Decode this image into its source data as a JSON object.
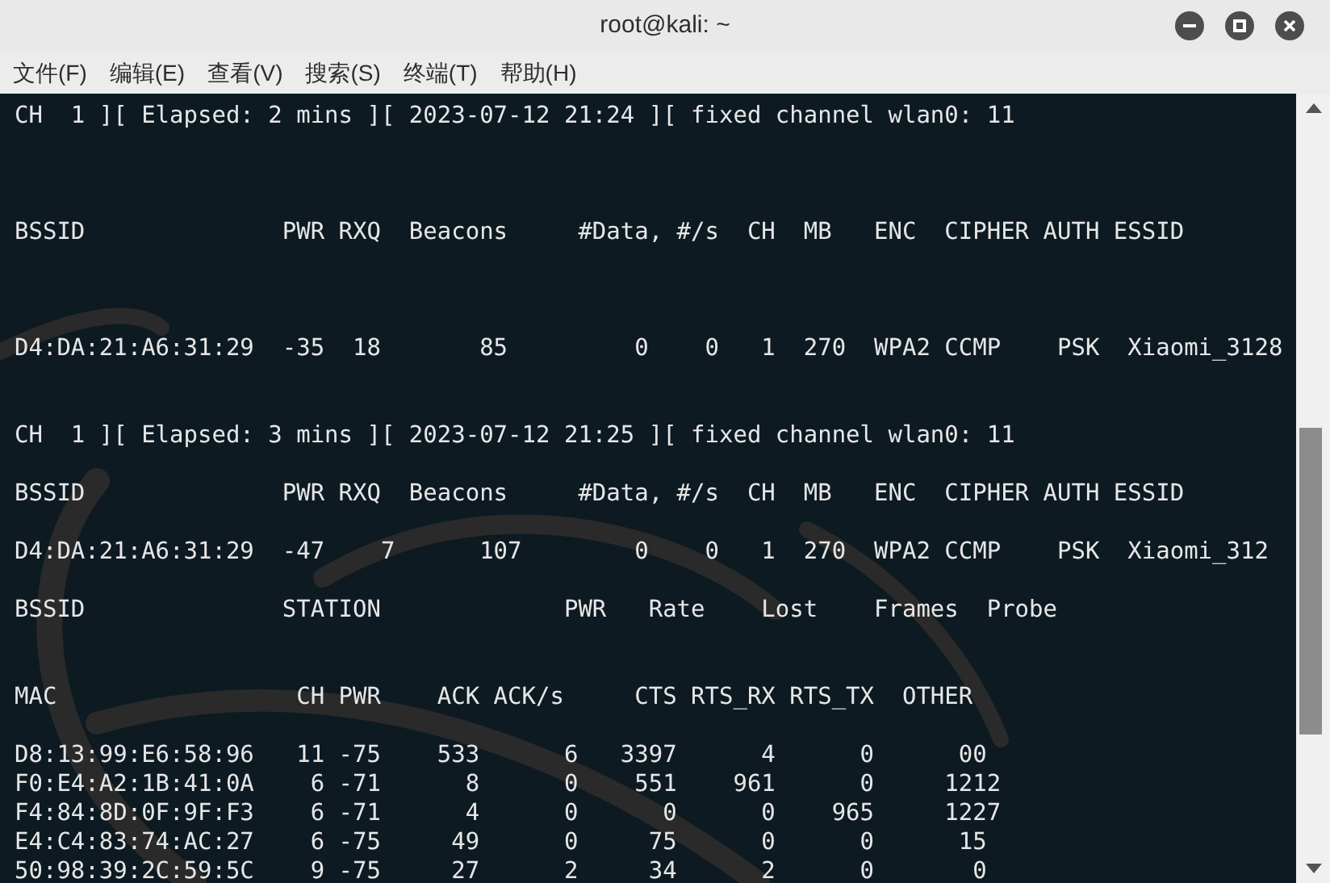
{
  "window": {
    "title": "root@kali: ~"
  },
  "menu": [
    "文件(F)",
    "编辑(E)",
    "查看(V)",
    "搜索(S)",
    "终端(T)",
    "帮助(H)"
  ],
  "terminal_lines": [
    "CH  1 ][ Elapsed: 2 mins ][ 2023-07-12 21:24 ][ fixed channel wlan0: 11",
    "BSSID              PWR RXQ  Beacons     #Data, #/s  CH  MB   ENC  CIPHER AUTH ESSID",
    "D4:DA:21:A6:31:29  -35  18       85         0    0   1  270  WPA2 CCMP    PSK  Xiaomi_3128",
    "CH  1 ][ Elapsed: 3 mins ][ 2023-07-12 21:25 ][ fixed channel wlan0: 11",
    "BSSID              PWR RXQ  Beacons     #Data, #/s  CH  MB   ENC  CIPHER AUTH ESSID",
    "D4:DA:21:A6:31:29  -47    7      107        0    0   1  270  WPA2 CCMP    PSK  Xiaomi_312",
    "BSSID              STATION             PWR   Rate    Lost    Frames  Probe",
    "MAC                 CH PWR    ACK ACK/s     CTS RTS_RX RTS_TX  OTHER",
    "D8:13:99:E6:58:96   11 -75    533      6   3397      4      0      00",
    "F0:E4:A2:1B:41:0A    6 -71      8      0    551    961      0     1212",
    "F4:84:8D:0F:9F:F3    6 -71      4      0      0      0    965     1227",
    "E4:C4:83:74:AC:27    6 -75     49      0     75      0      0      15",
    "50:98:39:2C:59:5C    9 -75     27      2     34      2      0       0"
  ]
}
